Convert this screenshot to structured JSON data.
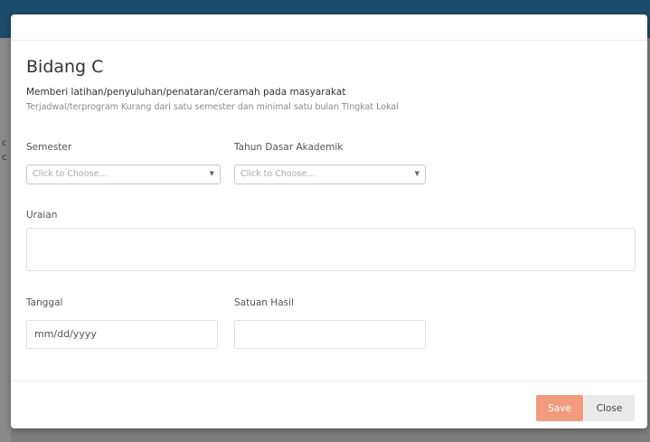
{
  "modal": {
    "title": "Bidang C",
    "description": "Memberi latihan/penyuluhan/penataran/ceramah pada masyarakat",
    "subdescription": "Terjadwal/terprogram Kurang dari satu semester dan minimal satu bulan Tingkat Lokal"
  },
  "form": {
    "semester": {
      "label": "Semester",
      "placeholder": "Click to Choose..."
    },
    "tahun": {
      "label": "Tahun Dasar Akademik",
      "placeholder": "Click to Choose..."
    },
    "uraian": {
      "label": "Uraian",
      "value": ""
    },
    "tanggal": {
      "label": "Tanggal",
      "placeholder": "mm/dd/yyyy"
    },
    "satuan": {
      "label": "Satuan Hasil",
      "value": ""
    }
  },
  "footer": {
    "save_label": "Save",
    "close_label": "Close"
  },
  "background": {
    "glyph1": "c",
    "glyph2": "c"
  },
  "colors": {
    "topbar": "#1e4b6b",
    "save_button": "#f29b7d",
    "close_button": "#eaeaea"
  },
  "icons": {
    "select_caret": "caret-down-icon"
  }
}
